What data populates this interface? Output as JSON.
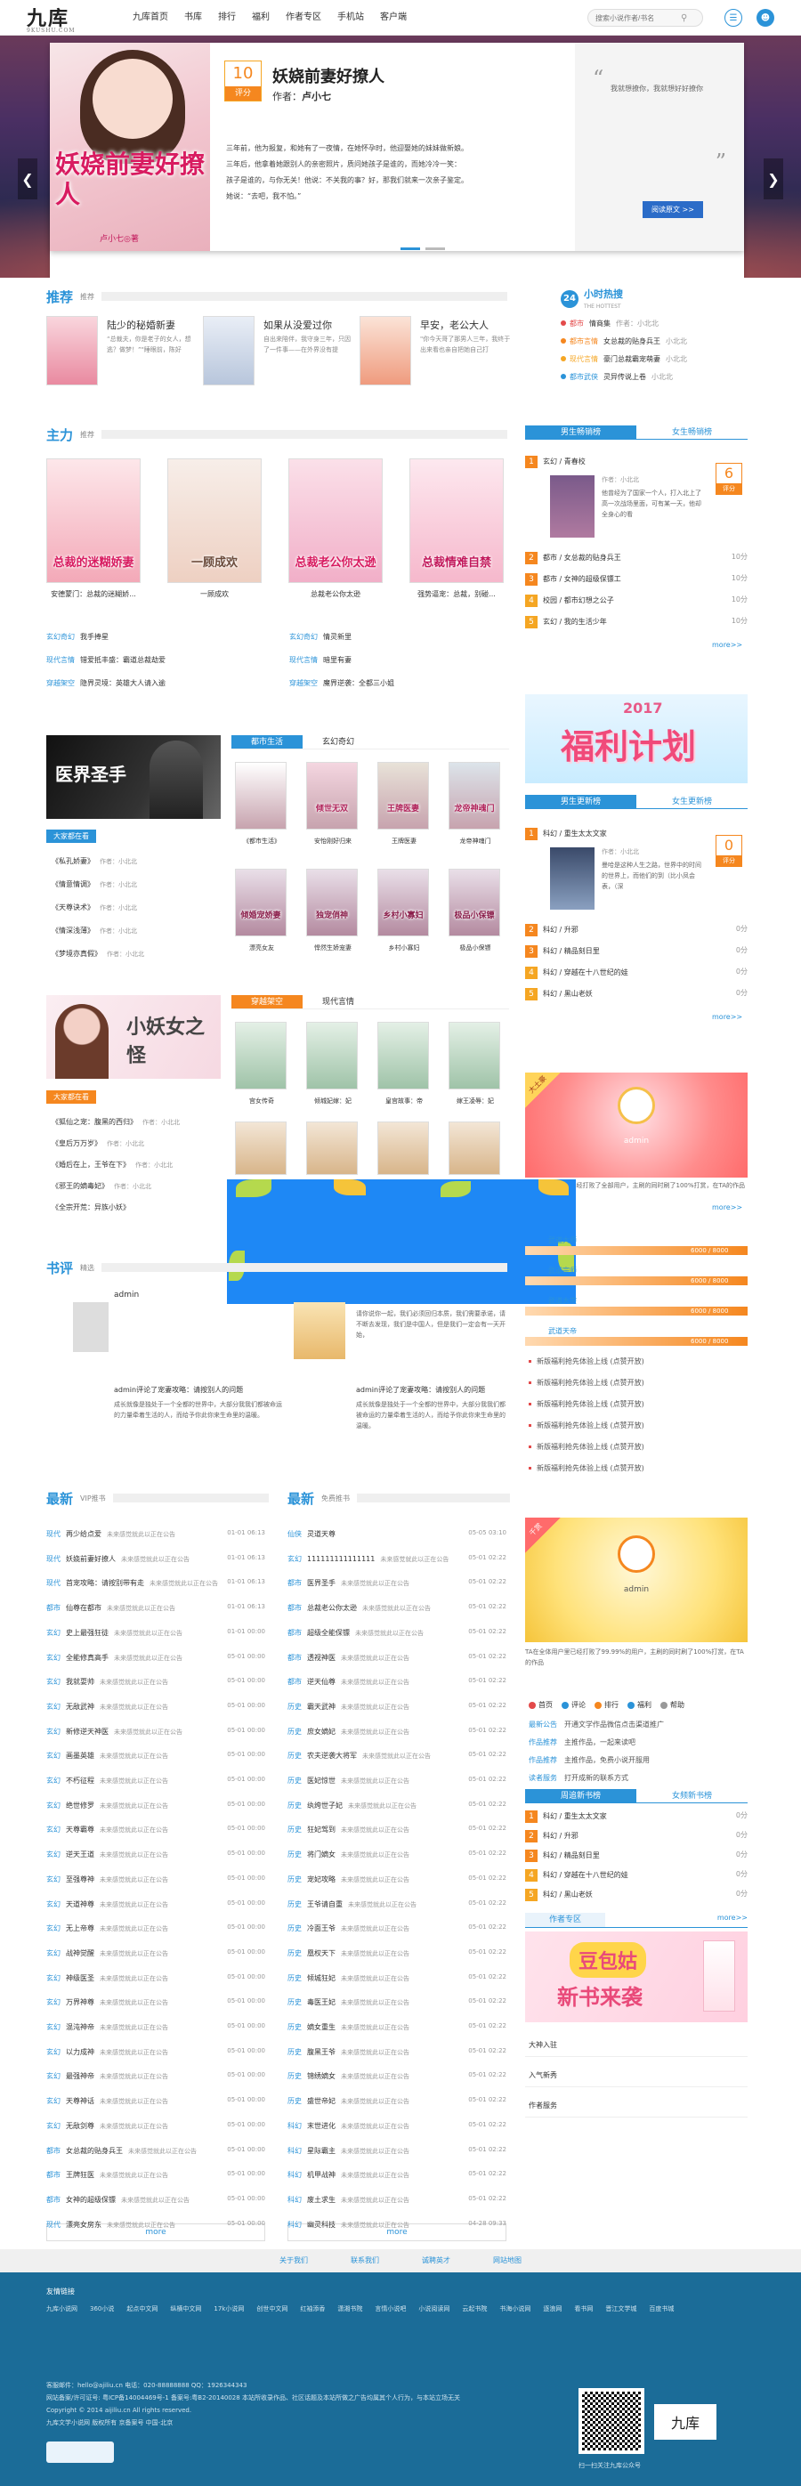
{
  "header": {
    "logo": "九库",
    "logo_sub": "9KUSHU.COM",
    "nav": [
      "九库首页",
      "书库",
      "排行",
      "福利",
      "作者专区",
      "手机站",
      "客户端"
    ],
    "search_placeholder": "搜索小说作者/书名"
  },
  "banner": {
    "cover_title": "妖娆前妻好撩人",
    "cover_author": "卢小七◎著",
    "score": "10",
    "score_label": "评分",
    "title": "妖娆前妻好撩人",
    "author_label": "作者：",
    "author": "卢小七",
    "desc_lines": [
      "三年前，他为报复，和她有了一夜情，在她怀孕时，他迎娶她的妹妹做新娘。",
      "三年后，他拿着她跟别人的亲密照片，质问她孩子是谁的，而她冷冷一笑：",
      "孩子是谁的，与你无关！他说：不关我的事？好，那我们就来一次亲子鉴定。",
      "她说：“去吧，我不怕。”"
    ],
    "quote": "我就想撩你，我就想好好撩你",
    "read_button": "阅读原文 >>"
  },
  "recommend": {
    "head_big": "推荐",
    "head_sm": "推荐",
    "items": [
      {
        "title": "陆少的秘婚新妻",
        "desc": "“总裁夫，你是老子的女人，想逃？做梦！”\"睡眼前，陈好"
      },
      {
        "title": "如果从没爱过你",
        "desc": "自出来陪伴，我守身三年，只因了一件事——在外界没有提"
      },
      {
        "title": "早安，老公大人",
        "desc": "\"你今天哥了那男人三年，我终于出来看也亲自把她自己打"
      }
    ]
  },
  "hot24": {
    "badge": "24",
    "title": "小时热搜",
    "sub": "THE HOTTEST",
    "items": [
      {
        "cat": "都市",
        "title": "情商集",
        "author": "作者：小北北"
      },
      {
        "cat": "都市言情",
        "title": "女总裁的贴身兵王",
        "author": "小北北"
      },
      {
        "cat": "现代言情",
        "title": "豪门总裁霸宠萌妻",
        "author": "小北北"
      },
      {
        "cat": "都市武侠",
        "title": "灵异传说上卷",
        "author": "小北北"
      }
    ]
  },
  "masterpiece": {
    "head_big": "主力",
    "head_sm": "推荐",
    "covers": [
      {
        "name": "总裁的迷糊娇妻",
        "caption": "安德蒙门：总裁的迷糊娇..."
      },
      {
        "name": "一顾成欢",
        "caption": "一顾成欢"
      },
      {
        "name": "总裁老公你太逊",
        "caption": "总裁老公你太逊"
      },
      {
        "name": "总裁情难自禁",
        "caption": "强势逼宠：总裁，别碰..."
      }
    ],
    "links_left": [
      {
        "cat": "玄幻奇幻",
        "title": "我手捧星"
      },
      {
        "cat": "现代言情",
        "title": "错爱抵丰盛：霸道总裁劫爱"
      },
      {
        "cat": "穿越架空",
        "title": "隐界灵境：英雄大人请入逾"
      }
    ],
    "links_right": [
      {
        "cat": "玄幻奇幻",
        "title": "情灵新里"
      },
      {
        "cat": "现代言情",
        "title": "暗里有妻"
      },
      {
        "cat": "穿越架空",
        "title": "魔界逆袭：全都三小姐"
      }
    ]
  },
  "male_rank": {
    "tabs": [
      "男生畅销榜",
      "女生畅销榜"
    ],
    "top": {
      "cat": "玄幻",
      "title": "青春校",
      "author": "作者：小北北",
      "desc": "他曾经为了国家一个人，打入北上了高一次战场里面，可有某一天，他却全身心的看"
    },
    "top_score": "6",
    "score_label": "评分",
    "rows": [
      {
        "n": "2",
        "text": "都市 / 女总裁的贴身兵王",
        "sc": "10分"
      },
      {
        "n": "3",
        "text": "都市 / 女神的超级保镖工",
        "sc": "10分"
      },
      {
        "n": "4",
        "text": "校园 / 都市幻想之公子",
        "sc": "10分"
      },
      {
        "n": "5",
        "text": "玄幻 / 我的生活少年",
        "sc": "10分"
      }
    ],
    "more": "more>>"
  },
  "promo": {
    "year": "2017",
    "text": "福利计划"
  },
  "update_rank": {
    "tabs": [
      "男生更新榜",
      "女生更新榜"
    ],
    "top": {
      "cat": "科幻",
      "title": "重生太太文家",
      "author": "作者：小北北",
      "desc": "曼哈是这种人生之路，世界中的时间的世界上，而他们的到（比小凤会表，（深"
    },
    "top_score": "0",
    "rows": [
      {
        "n": "2",
        "text": "科幻 / 升邪",
        "sc": "0分"
      },
      {
        "n": "3",
        "text": "科幻 / 精品刻日里",
        "sc": "0分"
      },
      {
        "n": "4",
        "text": "科幻 / 穿越在十八世纪的娃",
        "sc": "0分"
      },
      {
        "n": "5",
        "text": "科幻 / 黑山老妖",
        "sc": "0分"
      }
    ],
    "more": "more>>"
  },
  "city": {
    "tabs": [
      "都市生活",
      "玄幻奇幻"
    ],
    "banner_title": "医界圣手",
    "left_tag": "大家都在看",
    "left_list": [
      {
        "t": "《私孔娇妻》",
        "a": "作者：小北北"
      },
      {
        "t": "《情意情调》",
        "a": "作者：小北北"
      },
      {
        "t": "《天尊诀术》",
        "a": "作者：小北北"
      },
      {
        "t": "《情深浅薄》",
        "a": "作者：小北北"
      },
      {
        "t": "《梦境亦真假》",
        "a": "作者：小北北"
      }
    ],
    "covers_row1": [
      "",
      "倾世无双",
      "王牌医妻",
      "龙帝神魂门"
    ],
    "captions_row1": [
      "《都市生活》",
      "安怡刚好归来",
      "王牌医妻",
      "龙帝神魂门"
    ],
    "covers_row2": [
      "倾婚宠娇妻",
      "独宠俏神",
      "乡村小寡妇",
      "极品小保镖"
    ],
    "captions_row2": [
      "漂亮女友",
      "悍然生娇宠妻",
      "乡村小寡妇",
      "极品小保镖"
    ]
  },
  "romance": {
    "tabs": [
      "穿越架空",
      "现代言情"
    ],
    "banner_title": "小妖女之怪",
    "left_tag": "大家都在看",
    "left_list": [
      {
        "t": "《狐仙之宠：腹黑的西归》",
        "a": "作者：小北北"
      },
      {
        "t": "《皇后万万岁》",
        "a": "作者：小北北"
      },
      {
        "t": "《婚后在上，王爷在下》",
        "a": "作者：小北北"
      },
      {
        "t": "《邪王的嫡毒妃》",
        "a": "作者：小北北"
      },
      {
        "t": "《全宗开荒：异族小妖》",
        "a": ""
      }
    ],
    "captions": [
      "宫女传奇",
      "倾城妃嫁：妃",
      "皇宫故事：帝",
      "嫁王凌辱：妃"
    ]
  },
  "featured": {
    "head_big": "书评",
    "head_sm": "精选",
    "user1": "admin",
    "review1": "",
    "r1b": "admin评论了宠妻攻略：请按别人的问题",
    "r1c": "成长就像是独处于一个全都的世界中，大部分我我们都被命运的力量牵着生活的人，而给予你此你来生命里的温暖。",
    "review2": "请你说你一起，我们必须回归本质，我们需要承诺，请不断去发现，我们是中国人，但是我们一定会有一天开始，",
    "r2b": "admin评论了宠妻攻略：请按别人的问题",
    "r2c": "成长就像是独处于一个全都的世界中，大部分我我们都被命运的力量牵着生活的人，而给予你此你来生命里的温暖。"
  },
  "levels": {
    "rows": [
      {
        "label": "武道大师",
        "val": "6000 / 8000"
      },
      {
        "label": "武道宗师",
        "val": "6000 / 8000"
      },
      {
        "label": "武道大宗",
        "val": "6000 / 8000"
      },
      {
        "label": "武道天帝",
        "val": "6000 / 8000"
      }
    ],
    "news": [
      "新版福利抢先体验上线 (点赞开放)",
      "新版福利抢先体验上线 (点赞开放)",
      "新版福利抢先体验上线 (点赞开放)",
      "新版福利抢先体验上线 (点赞开放)",
      "新版福利抢先体验上线 (点赞开放)",
      "新版福利抢先体验上线 (点赞开放)"
    ]
  },
  "admin_card": {
    "ribbon": "大土豪",
    "name": "admin",
    "desc": "TA在全体用户里已经打败了全部用户，主刷的同时刷了100%打赏，在TA的作品",
    "ribbon2": "千赏",
    "desc2": "TA在全体用户里已经打败了99.99%的用户，主刷的同时刷了100%打赏，在TA的作品"
  },
  "user_actions": {
    "items": [
      "首页",
      "评论",
      "排行",
      "福利",
      "帮助"
    ],
    "lines": [
      {
        "k": "最新公告",
        "v": "开通文学作品微信点击渠道推广"
      },
      {
        "k": "作品推荐",
        "v": "主推作品，一起来读吧"
      },
      {
        "k": "作品推荐",
        "v": "主推作品，免费小说开服用"
      },
      {
        "k": "读者服务",
        "v": "打开成新的联系方式"
      }
    ]
  },
  "weekly_rank": {
    "tabs": [
      "周追新书榜",
      "女频新书榜"
    ],
    "rows": [
      {
        "n": "1",
        "text": "科幻 / 重生太太文家",
        "sc": "0分"
      },
      {
        "n": "2",
        "text": "科幻 / 升邪",
        "sc": "0分"
      },
      {
        "n": "3",
        "text": "科幻 / 精品刻日里",
        "sc": "0分"
      },
      {
        "n": "4",
        "text": "科幻 / 穿越在十八世纪的娃",
        "sc": "0分"
      },
      {
        "n": "5",
        "text": "科幻 / 黑山老妖",
        "sc": "0分"
      }
    ]
  },
  "author_zone": {
    "title": "作者专区",
    "more": "more>>",
    "promo_big": "豆包姑",
    "promo_small": "新书来袭",
    "links": [
      "大神入驻",
      "入气新秀",
      "作者服务"
    ]
  },
  "latest_vip": {
    "head_big": "最新",
    "head_sm": "VIP推书",
    "rows": [
      {
        "c": "现代",
        "t": "再少给点爱",
        "s": "未来感觉就此以正在公告",
        "d": "01-01 06:13"
      },
      {
        "c": "现代",
        "t": "妖娆前妻好撩人",
        "s": "未来感觉就此以正在公告",
        "d": "01-01 06:13"
      },
      {
        "c": "现代",
        "t": "首宠攻略：请按别带有走",
        "s": "未来感觉就此以正在公告",
        "d": "01-01 06:13"
      },
      {
        "c": "都市",
        "t": "仙尊在都市",
        "s": "未来感觉就此以正在公告",
        "d": "01-01 06:13"
      },
      {
        "c": "玄幻",
        "t": "史上最强狂徒",
        "s": "未来感觉就此以正在公告",
        "d": "01-01 00:00"
      },
      {
        "c": "玄幻",
        "t": "全能修真高手",
        "s": "未来感觉就此以正在公告",
        "d": "05-01 00:00"
      },
      {
        "c": "玄幻",
        "t": "我就耍帅",
        "s": "未来感觉就此以正在公告",
        "d": "05-01 00:00"
      },
      {
        "c": "玄幻",
        "t": "无敌武神",
        "s": "未来感觉就此以正在公告",
        "d": "05-01 00:00"
      },
      {
        "c": "玄幻",
        "t": "新修逆天神医",
        "s": "未来感觉就此以正在公告",
        "d": "05-01 00:00"
      },
      {
        "c": "玄幻",
        "t": "画墨英雄",
        "s": "未来感觉就此以正在公告",
        "d": "05-01 00:00"
      },
      {
        "c": "玄幻",
        "t": "不朽征程",
        "s": "未来感觉就此以正在公告",
        "d": "05-01 00:00"
      },
      {
        "c": "玄幻",
        "t": "绝世修罗",
        "s": "未来感觉就此以正在公告",
        "d": "05-01 00:00"
      },
      {
        "c": "玄幻",
        "t": "天尊霸尊",
        "s": "未来感觉就此以正在公告",
        "d": "05-01 00:00"
      },
      {
        "c": "玄幻",
        "t": "逆天王道",
        "s": "未来感觉就此以正在公告",
        "d": "05-01 00:00"
      },
      {
        "c": "玄幻",
        "t": "至强尊神",
        "s": "未来感觉就此以正在公告",
        "d": "05-01 00:00"
      },
      {
        "c": "玄幻",
        "t": "天道神尊",
        "s": "未来感觉就此以正在公告",
        "d": "05-01 00:00"
      },
      {
        "c": "玄幻",
        "t": "无上帝尊",
        "s": "未来感觉就此以正在公告",
        "d": "05-01 00:00"
      },
      {
        "c": "玄幻",
        "t": "战神觉醒",
        "s": "未来感觉就此以正在公告",
        "d": "05-01 00:00"
      },
      {
        "c": "玄幻",
        "t": "神级医圣",
        "s": "未来感觉就此以正在公告",
        "d": "05-01 00:00"
      },
      {
        "c": "玄幻",
        "t": "万界神尊",
        "s": "未来感觉就此以正在公告",
        "d": "05-01 00:00"
      },
      {
        "c": "玄幻",
        "t": "混沌神帝",
        "s": "未来感觉就此以正在公告",
        "d": "05-01 00:00"
      },
      {
        "c": "玄幻",
        "t": "以力成神",
        "s": "未来感觉就此以正在公告",
        "d": "05-01 00:00"
      },
      {
        "c": "玄幻",
        "t": "最强神帝",
        "s": "未来感觉就此以正在公告",
        "d": "05-01 00:00"
      },
      {
        "c": "玄幻",
        "t": "天尊神话",
        "s": "未来感觉就此以正在公告",
        "d": "05-01 00:00"
      },
      {
        "c": "玄幻",
        "t": "无敌剑尊",
        "s": "未来感觉就此以正在公告",
        "d": "05-01 00:00"
      },
      {
        "c": "都市",
        "t": "女总裁的贴身兵王",
        "s": "未来感觉就此以正在公告",
        "d": "05-01 00:00"
      },
      {
        "c": "都市",
        "t": "王牌狂医",
        "s": "未来感觉就此以正在公告",
        "d": "05-01 00:00"
      },
      {
        "c": "都市",
        "t": "女神的超级保镖",
        "s": "未来感觉就此以正在公告",
        "d": "05-01 00:00"
      },
      {
        "c": "现代",
        "t": "漂亮女房东",
        "s": "未来感觉就此以正在公告",
        "d": "05-01 00:00"
      }
    ],
    "more": "more"
  },
  "latest_free": {
    "head_big": "最新",
    "head_sm": "免费推书",
    "rows": [
      {
        "c": "仙侠",
        "t": "灵道天尊",
        "s": "",
        "d": "05-05 03:10"
      },
      {
        "c": "玄幻",
        "t": "111111111111111",
        "s": "未来感觉就此以正在公告",
        "d": "05-01 02:22"
      },
      {
        "c": "都市",
        "t": "医界圣手",
        "s": "未来感觉就此以正在公告",
        "d": "05-01 02:22"
      },
      {
        "c": "都市",
        "t": "总裁老公你太逊",
        "s": "未来感觉就此以正在公告",
        "d": "05-01 02:22"
      },
      {
        "c": "都市",
        "t": "超级全能保镖",
        "s": "未来感觉就此以正在公告",
        "d": "05-01 02:22"
      },
      {
        "c": "都市",
        "t": "透视神医",
        "s": "未来感觉就此以正在公告",
        "d": "05-01 02:22"
      },
      {
        "c": "都市",
        "t": "逆天仙尊",
        "s": "未来感觉就此以正在公告",
        "d": "05-01 02:22"
      },
      {
        "c": "历史",
        "t": "霸天武神",
        "s": "未来感觉就此以正在公告",
        "d": "05-01 02:22"
      },
      {
        "c": "历史",
        "t": "庶女嫡妃",
        "s": "未来感觉就此以正在公告",
        "d": "05-01 02:22"
      },
      {
        "c": "历史",
        "t": "农夫逆袭大将军",
        "s": "未来感觉就此以正在公告",
        "d": "05-01 02:22"
      },
      {
        "c": "历史",
        "t": "医妃惊世",
        "s": "未来感觉就此以正在公告",
        "d": "05-01 02:22"
      },
      {
        "c": "历史",
        "t": "纨绔世子妃",
        "s": "未来感觉就此以正在公告",
        "d": "05-01 02:22"
      },
      {
        "c": "历史",
        "t": "狂妃驾到",
        "s": "未来感觉就此以正在公告",
        "d": "05-01 02:22"
      },
      {
        "c": "历史",
        "t": "将门嫡女",
        "s": "未来感觉就此以正在公告",
        "d": "05-01 02:22"
      },
      {
        "c": "历史",
        "t": "宠妃攻略",
        "s": "未来感觉就此以正在公告",
        "d": "05-01 02:22"
      },
      {
        "c": "历史",
        "t": "王爷请自重",
        "s": "未来感觉就此以正在公告",
        "d": "05-01 02:22"
      },
      {
        "c": "历史",
        "t": "冷面王爷",
        "s": "未来感觉就此以正在公告",
        "d": "05-01 02:22"
      },
      {
        "c": "历史",
        "t": "凰权天下",
        "s": "未来感觉就此以正在公告",
        "d": "05-01 02:22"
      },
      {
        "c": "历史",
        "t": "倾城狂妃",
        "s": "未来感觉就此以正在公告",
        "d": "05-01 02:22"
      },
      {
        "c": "历史",
        "t": "毒医王妃",
        "s": "未来感觉就此以正在公告",
        "d": "05-01 02:22"
      },
      {
        "c": "历史",
        "t": "嫡女重生",
        "s": "未来感觉就此以正在公告",
        "d": "05-01 02:22"
      },
      {
        "c": "历史",
        "t": "腹黑王爷",
        "s": "未来感觉就此以正在公告",
        "d": "05-01 02:22"
      },
      {
        "c": "历史",
        "t": "锦绣嫡女",
        "s": "未来感觉就此以正在公告",
        "d": "05-01 02:22"
      },
      {
        "c": "历史",
        "t": "盛世帝妃",
        "s": "未来感觉就此以正在公告",
        "d": "05-01 02:22"
      },
      {
        "c": "科幻",
        "t": "末世进化",
        "s": "未来感觉就此以正在公告",
        "d": "05-01 02:22"
      },
      {
        "c": "科幻",
        "t": "星际霸主",
        "s": "未来感觉就此以正在公告",
        "d": "05-01 02:22"
      },
      {
        "c": "科幻",
        "t": "机甲战神",
        "s": "未来感觉就此以正在公告",
        "d": "05-01 02:22"
      },
      {
        "c": "科幻",
        "t": "废土求生",
        "s": "未来感觉就此以正在公告",
        "d": "05-01 02:22"
      },
      {
        "c": "科幻",
        "t": "幽灵科技",
        "s": "未来感觉就此以正在公告",
        "d": "04-28 09:33"
      }
    ],
    "more": "more"
  },
  "footer": {
    "links": [
      "关于我们",
      "联系我们",
      "诚聘英才",
      "网站地图"
    ],
    "friend_title": "友情链接",
    "friends": [
      "九库小说网",
      "360小说",
      "起点中文网",
      "纵横中文网",
      "17k小说网",
      "创世中文网",
      "红袖添香",
      "潇湘书院",
      "言情小说吧",
      "小说阅读网",
      "云起书院",
      "书海小说网",
      "逐浪网",
      "看书网",
      "晋江文学城",
      "百度书城"
    ],
    "contact": "客服邮件：hello@ajiliu.cn   电话：020-88888888   QQ：1926344343",
    "icp": "网站备案/许可证号: 粤ICP备14004469号-1   备案号:粤B2-20140028   本站所收录作品、社区话题及本站所做之广告均属其个人行为，与本站立场无关",
    "copyright": "Copyright © 2014 aijiliu.cn All rights reserved.",
    "extra": "九库文学小说网   版权所有   京备案号   中国-北京",
    "qr_label": "扫一扫关注九库公众号"
  }
}
